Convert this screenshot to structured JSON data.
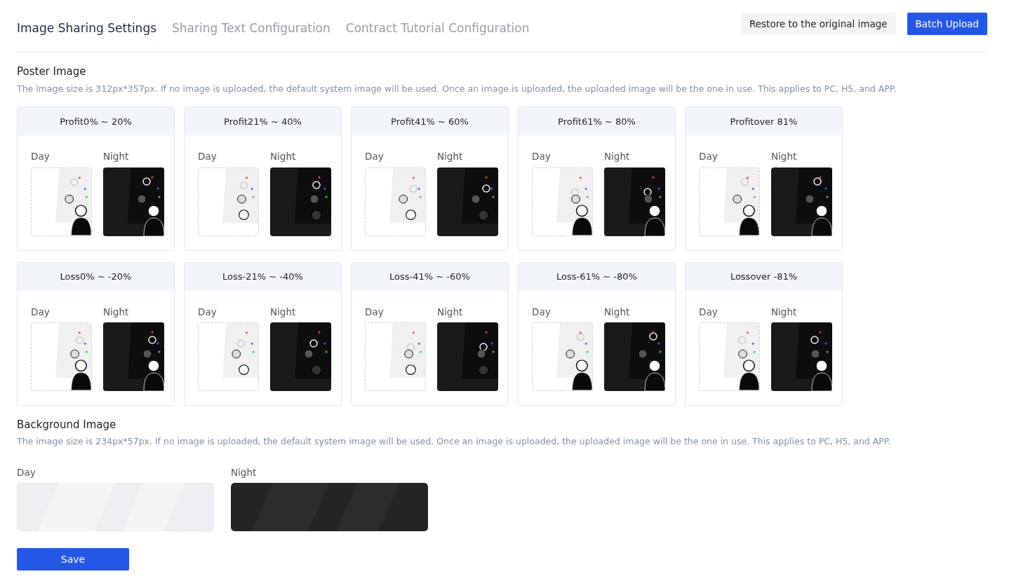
{
  "tabs": [
    {
      "label": "Image Sharing Settings",
      "selected": true
    },
    {
      "label": "Sharing Text Configuration",
      "selected": false
    },
    {
      "label": "Contract Tutorial Configuration",
      "selected": false
    }
  ],
  "actions": [
    {
      "label": "Restore to the original image",
      "kind": "secondary"
    },
    {
      "label": "Batch Upload",
      "kind": "primary"
    }
  ],
  "poster": {
    "title": "Poster Image",
    "note": "The image size is 312px*357px. If no image is uploaded, the default system image will be used. Once an image is uploaded, the uploaded image will be the one in use. This applies to PC, H5, and APP.",
    "cards": [
      {
        "title": "Profit0% ~ 20%",
        "day": "Day",
        "night": "Night"
      },
      {
        "title": "Profit21% ~ 40%",
        "day": "Day",
        "night": "Night"
      },
      {
        "title": "Profit41% ~ 60%",
        "day": "Day",
        "night": "Night"
      },
      {
        "title": "Profit61% ~ 80%",
        "day": "Day",
        "night": "Night"
      },
      {
        "title": "Profitover 81%",
        "day": "Day",
        "night": "Night"
      },
      {
        "title": "Loss0% ~ -20%",
        "day": "Day",
        "night": "Night"
      },
      {
        "title": "Loss-21% ~ -40%",
        "day": "Day",
        "night": "Night"
      },
      {
        "title": "Loss-41% ~ -60%",
        "day": "Day",
        "night": "Night"
      },
      {
        "title": "Loss-61% ~ -80%",
        "day": "Day",
        "night": "Night"
      },
      {
        "title": "Lossover -81%",
        "day": "Day",
        "night": "Night"
      }
    ]
  },
  "background": {
    "title": "Background Image",
    "note": "The image size is 234px*57px. If no image is uploaded, the default system image will be used. Once an image is uploaded, the uploaded image will be the one in use. This applies to PC, H5, and APP.",
    "day": "Day",
    "night": "Night"
  },
  "save": "Save"
}
